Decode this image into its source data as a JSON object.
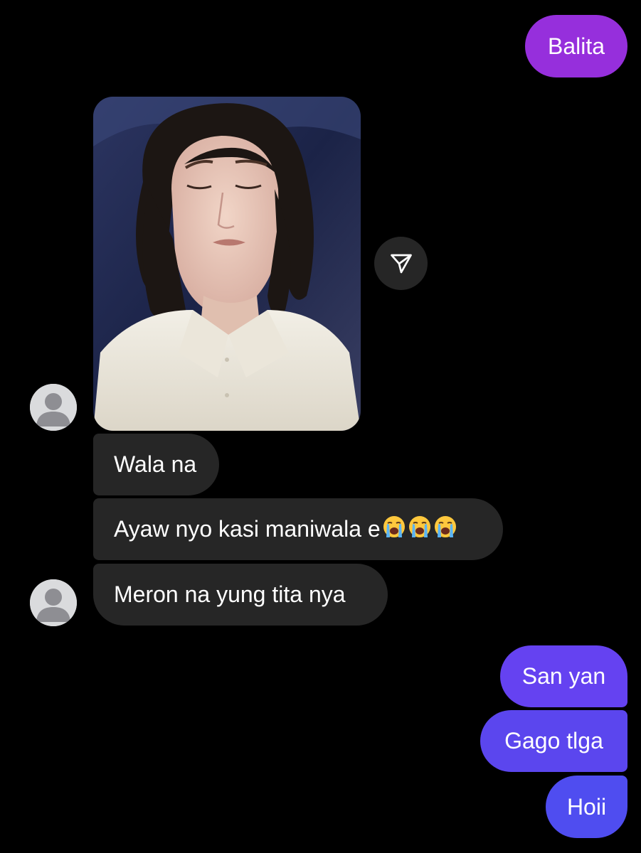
{
  "thread": {
    "outgoing_top": {
      "text": "Balita",
      "color": "#962fdc"
    },
    "photo": {
      "alt": ""
    },
    "share_icon": "send-icon",
    "incoming": [
      {
        "text": "Wala na"
      },
      {
        "text": "Ayaw nyo kasi maniwala e",
        "emoji": "😭😭😭"
      },
      {
        "text": "Meron na yung tita nya"
      }
    ],
    "outgoing": [
      {
        "text": "San yan",
        "color": "#6542f1"
      },
      {
        "text": "Gago tlga",
        "color": "#5b46ee"
      },
      {
        "text": "Hoii",
        "color": "#4f4df0"
      }
    ],
    "avatar_icon": "default-user-avatar-icon"
  },
  "colors": {
    "incoming_bubble": "#262626",
    "background": "#000000",
    "text": "#ffffff"
  }
}
